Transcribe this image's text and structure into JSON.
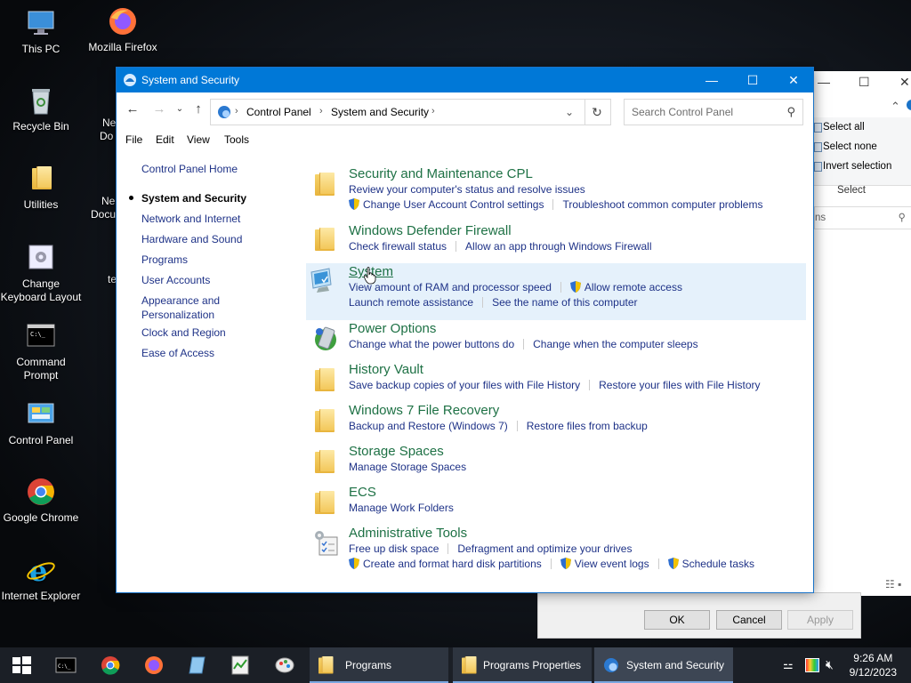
{
  "desktop": {
    "icons": [
      {
        "label": "This PC"
      },
      {
        "label": "Mozilla Firefox"
      },
      {
        "label": "Recycle Bin"
      },
      {
        "label": "Utilities"
      },
      {
        "label": "Change Keyboard Layout"
      },
      {
        "label": "Command Prompt"
      },
      {
        "label": "Control Panel"
      },
      {
        "label": "Google Chrome"
      },
      {
        "label": "Internet Explorer"
      }
    ],
    "partial": [
      "Ne",
      "Do",
      "Ne",
      "Docu",
      "te"
    ]
  },
  "background_window": {
    "ribbon": [
      "Select all",
      "Select none",
      "Invert selection"
    ],
    "group": "Select",
    "search_partial": "ns",
    "buttons": {
      "ok": "OK",
      "cancel": "Cancel",
      "apply": "Apply"
    }
  },
  "window": {
    "title": "System and Security",
    "controls": {
      "minimize": "—",
      "maximize": "☐",
      "close": "✕"
    },
    "breadcrumb": [
      "Control Panel",
      "System and Security"
    ],
    "search_placeholder": "Search Control Panel",
    "menu": [
      "File",
      "Edit",
      "View",
      "Tools"
    ],
    "leftnav": [
      "Control Panel Home",
      "System and Security",
      "Network and Internet",
      "Hardware and Sound",
      "Programs",
      "User Accounts",
      "Appearance and Personalization",
      "Clock and Region",
      "Ease of Access"
    ],
    "categories": [
      {
        "title": "Security and Maintenance CPL",
        "rows": [
          [
            "Review your computer's status and resolve issues"
          ],
          [
            "Change User Account Control settings",
            "Troubleshoot common computer problems"
          ]
        ]
      },
      {
        "title": "Windows Defender Firewall",
        "rows": [
          [
            "Check firewall status",
            "Allow an app through Windows Firewall"
          ]
        ]
      },
      {
        "title": "System",
        "rows": [
          [
            "View amount of RAM and processor speed",
            "Allow remote access"
          ],
          [
            "Launch remote assistance",
            "See the name of this computer"
          ]
        ]
      },
      {
        "title": "Power Options",
        "rows": [
          [
            "Change what the power buttons do",
            "Change when the computer sleeps"
          ]
        ]
      },
      {
        "title": "History Vault",
        "rows": [
          [
            "Save backup copies of your files with File History",
            "Restore your files with File History"
          ]
        ]
      },
      {
        "title": "Windows 7 File Recovery",
        "rows": [
          [
            "Backup and Restore (Windows 7)",
            "Restore files from backup"
          ]
        ]
      },
      {
        "title": "Storage Spaces",
        "rows": [
          [
            "Manage Storage Spaces"
          ]
        ]
      },
      {
        "title": "ECS",
        "rows": [
          [
            "Manage Work Folders"
          ]
        ]
      },
      {
        "title": "Administrative Tools",
        "rows": [
          [
            "Free up disk space",
            "Defragment and optimize your drives"
          ],
          [
            "Create and format hard disk partitions",
            "View event logs",
            "Schedule tasks"
          ]
        ]
      }
    ]
  },
  "taskbar": {
    "apps": [
      "Programs",
      "Programs Properties",
      "System and Security"
    ],
    "time": "9:26 AM",
    "date": "9/12/2023"
  },
  "colors": {
    "accent": "#0078d7",
    "link": "#1e3287",
    "heading": "#1e7145",
    "hover": "#e5f1fb"
  }
}
